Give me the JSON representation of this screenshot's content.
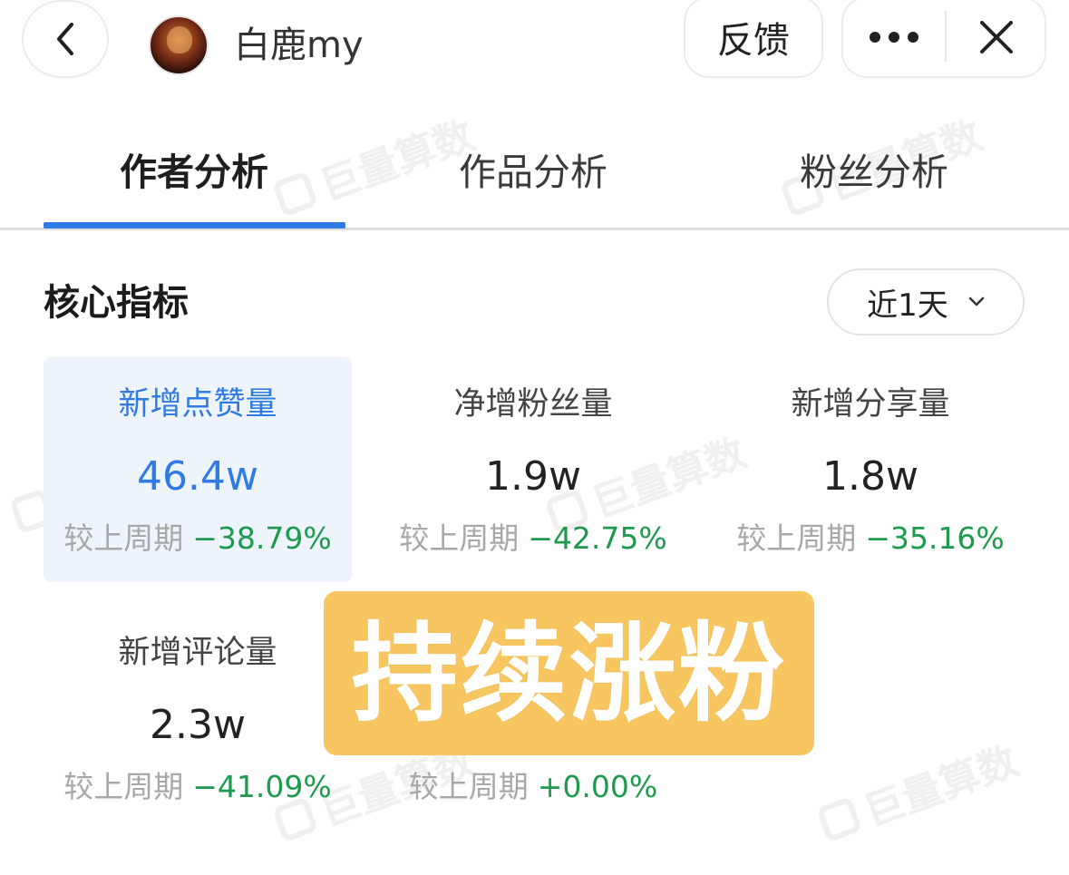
{
  "header": {
    "username": "白鹿my",
    "feedback_label": "反馈"
  },
  "tabs": [
    {
      "label": "作者分析",
      "active": true
    },
    {
      "label": "作品分析",
      "active": false
    },
    {
      "label": "粉丝分析",
      "active": false
    }
  ],
  "section": {
    "title": "核心指标",
    "period": "近1天"
  },
  "metrics": [
    {
      "label": "新增点赞量",
      "value": "46.4w",
      "compare_label": "较上周期",
      "change": "−38.79%",
      "selected": true
    },
    {
      "label": "净增粉丝量",
      "value": "1.9w",
      "compare_label": "较上周期",
      "change": "−42.75%",
      "selected": false
    },
    {
      "label": "新增分享量",
      "value": "1.8w",
      "compare_label": "较上周期",
      "change": "−35.16%",
      "selected": false
    },
    {
      "label": "新增评论量",
      "value": "2.3w",
      "compare_label": "较上周期",
      "change": "−41.09%",
      "selected": false
    },
    {
      "label": "",
      "value": "",
      "compare_label": "较上周期",
      "change": "+0.00%",
      "selected": false
    }
  ],
  "sticker": {
    "text": "持续涨粉"
  },
  "watermark": {
    "text": "巨量算数"
  },
  "colors": {
    "accent": "#2f7be3",
    "positive_change": "#1e9a4e",
    "selected_card_bg": "#eef4fc",
    "sticker_bg": "#f7c660"
  },
  "icons": {
    "back": "chevron-left-icon",
    "more": "more-dots-icon",
    "close": "close-icon",
    "dropdown": "chevron-down-icon"
  }
}
